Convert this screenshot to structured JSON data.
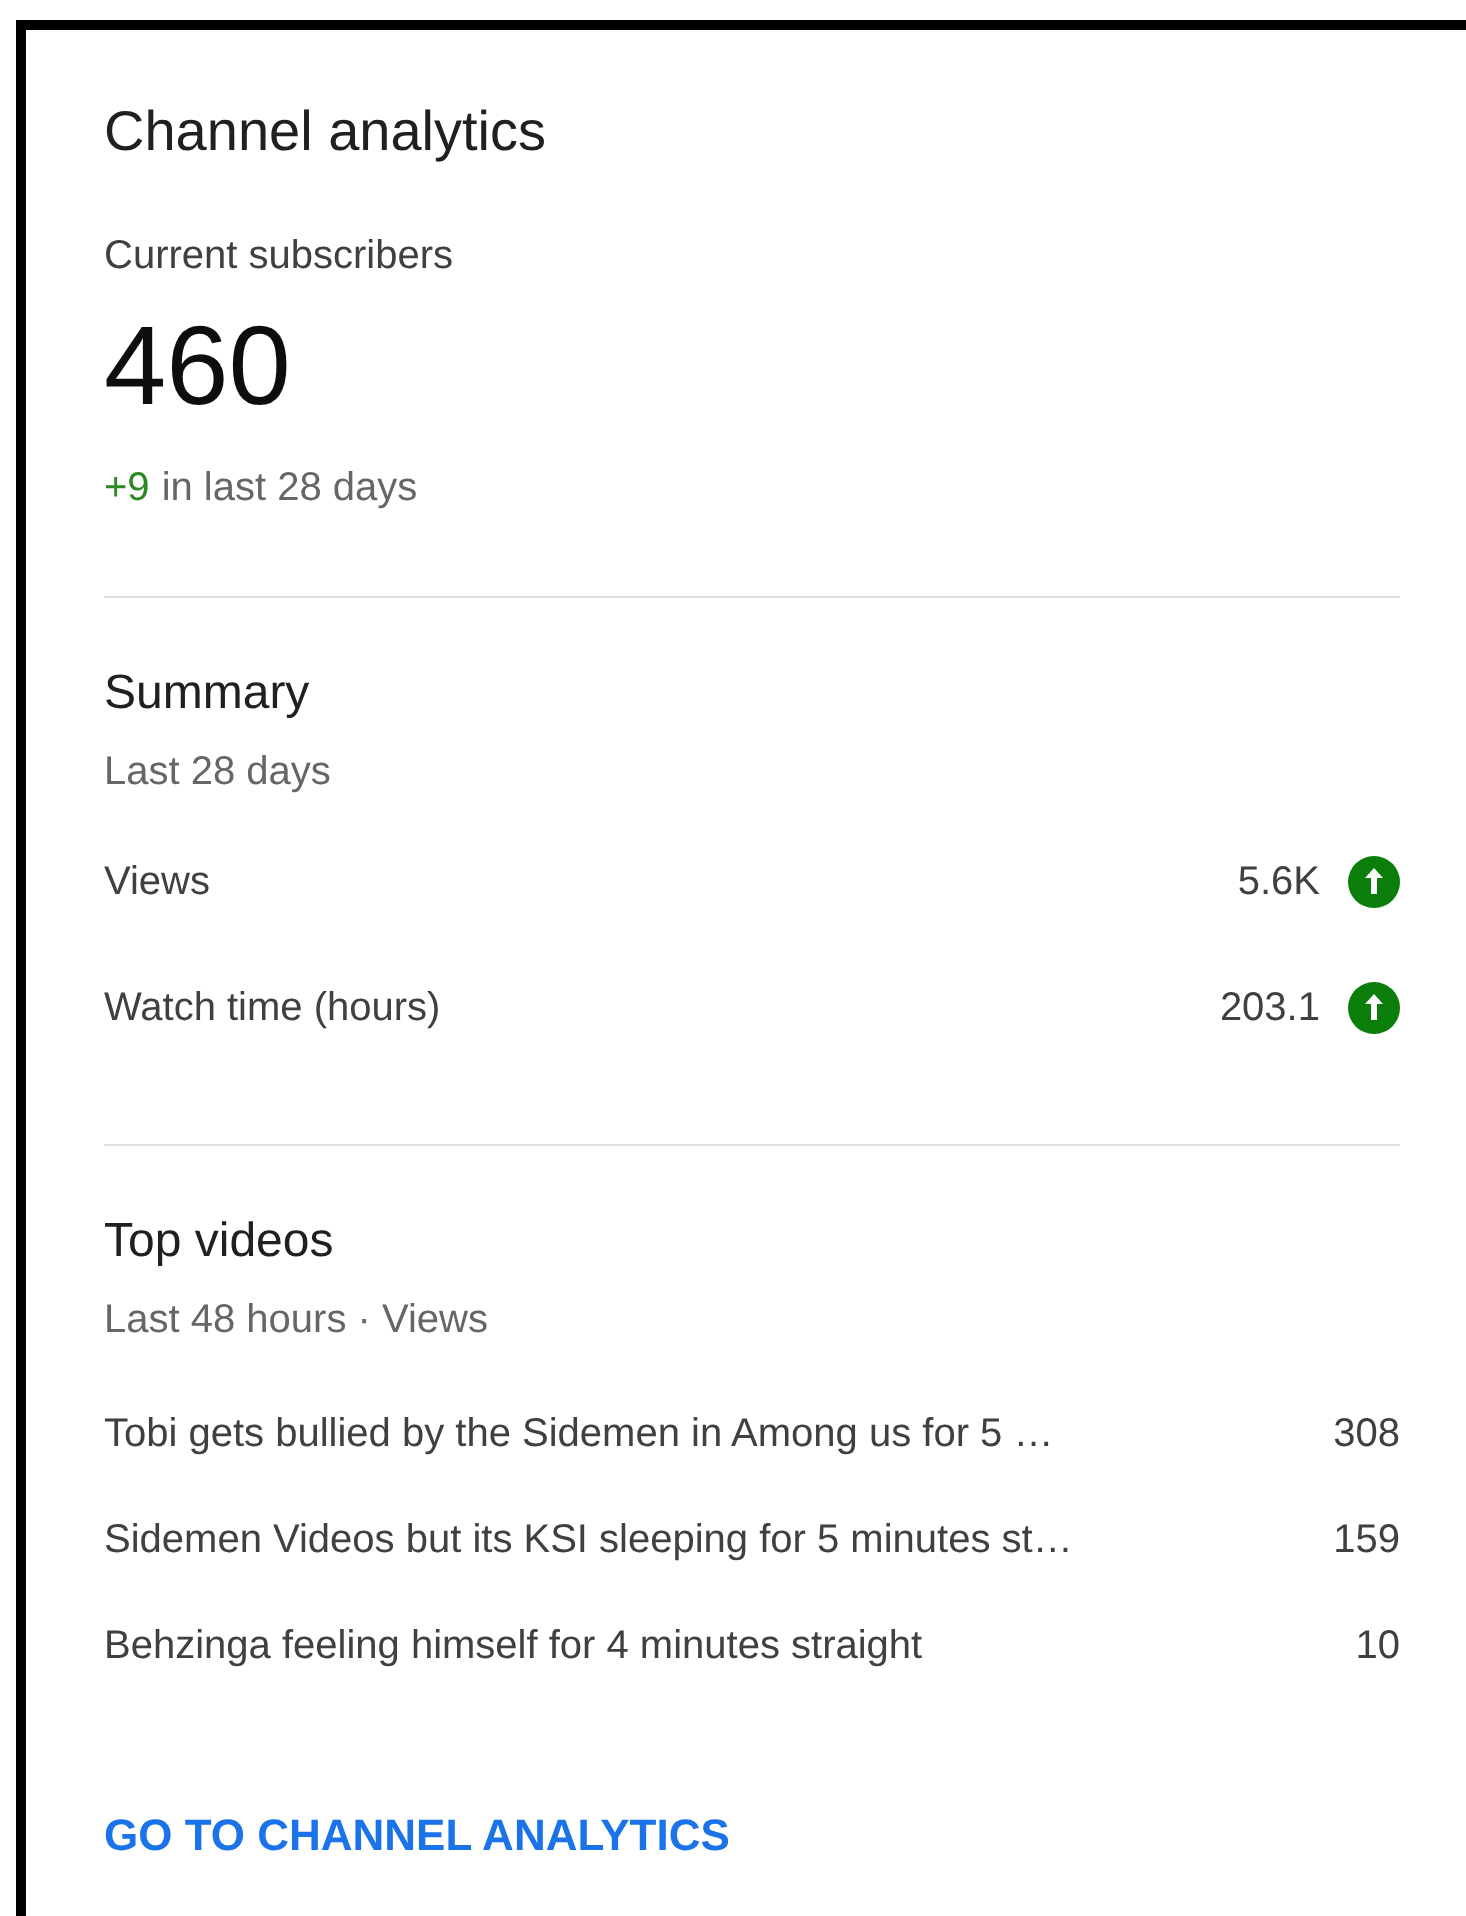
{
  "card": {
    "title": "Channel analytics",
    "subscribers": {
      "label": "Current subscribers",
      "count": "460",
      "change": "+9",
      "change_text": "in last 28 days"
    },
    "summary": {
      "title": "Summary",
      "period": "Last 28 days",
      "metrics": [
        {
          "label": "Views",
          "value": "5.6K",
          "rising": true
        },
        {
          "label": "Watch time (hours)",
          "value": "203.1",
          "rising": true
        }
      ]
    },
    "top_videos": {
      "title": "Top videos",
      "period": "Last 48 hours · Views",
      "videos": [
        {
          "title": "Tobi gets bullied by the Sidemen in Among us for 5 …",
          "views": "308"
        },
        {
          "title": "Sidemen Videos but its KSI sleeping for 5 minutes st…",
          "views": "159"
        },
        {
          "title": "Behzinga feeling himself for 4 minutes straight",
          "views": "10"
        }
      ]
    },
    "link": "GO TO CHANNEL ANALYTICS"
  }
}
